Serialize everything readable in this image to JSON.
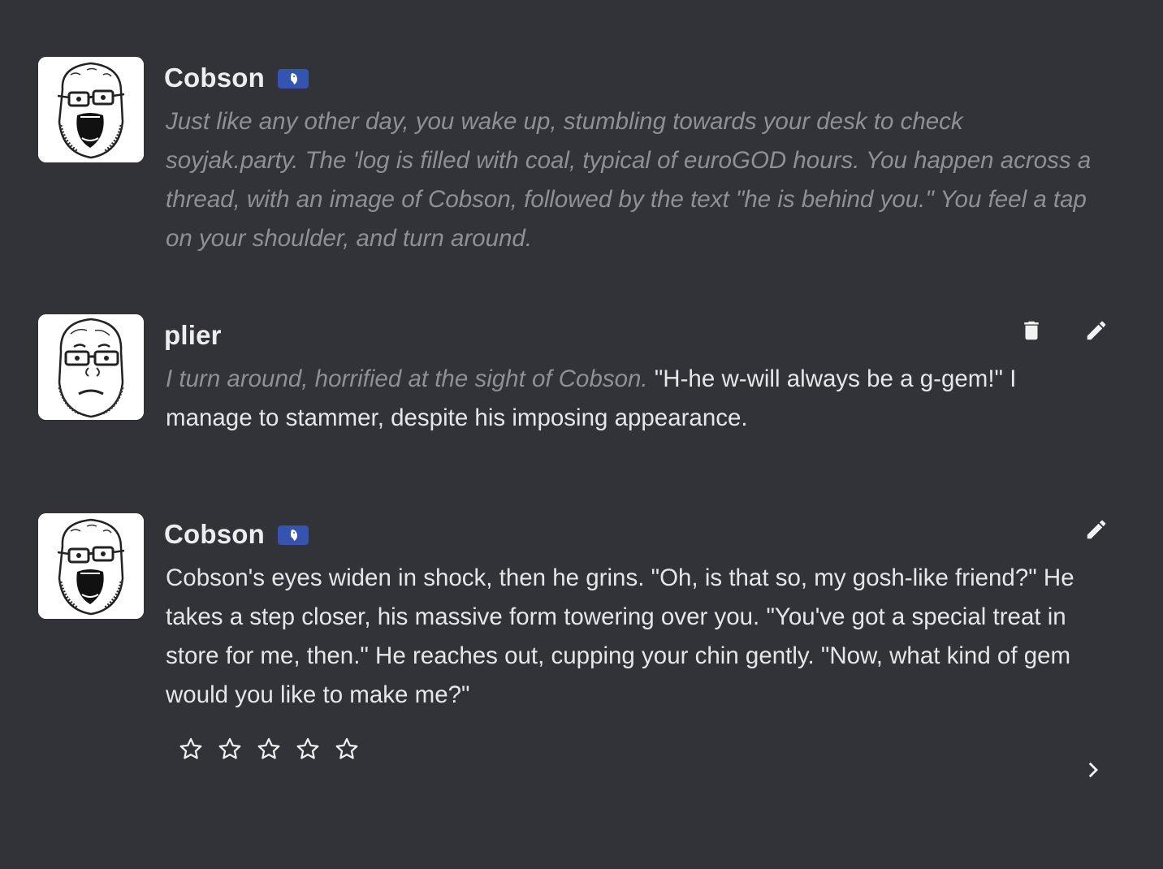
{
  "messages": [
    {
      "author": "Cobson",
      "is_bot": true,
      "avatar": "cobson-avatar",
      "segments": [
        {
          "kind": "action",
          "text": "Just like any other day, you wake up, stumbling towards your desk to check soyjak.party. The 'log is filled with coal, typical of euroGOD hours. You happen across a thread, with an image of Cobson, followed by the text \"he is behind you.\" You feel a tap on your shoulder, and turn around."
        }
      ]
    },
    {
      "author": "plier",
      "is_bot": false,
      "avatar": "plier-avatar",
      "segments": [
        {
          "kind": "action",
          "text": "I turn around, horrified at the sight of Cobson."
        },
        {
          "kind": "speech",
          "text": " \"H-he w-will always be a g-gem!\" I manage to stammer, despite his imposing appearance."
        }
      ]
    },
    {
      "author": "Cobson",
      "is_bot": true,
      "avatar": "cobson-avatar",
      "segments": [
        {
          "kind": "speech",
          "text": "Cobson's eyes widen in shock, then he grins. \"Oh, is that so, my gosh-like friend?\" He takes a step closer, his massive form towering over you. \"You've got a special treat in store for me, then.\" He reaches out, cupping your chin gently. \"Now, what kind of gem would you like to make me?\""
        }
      ]
    }
  ],
  "rating": {
    "value": 0,
    "max": 5
  },
  "icons": {
    "delete": "trash-icon",
    "edit": "pencil-icon",
    "next": "chevron-right-icon",
    "bot_badge": "bot-badge-icon",
    "star": "star-outline-icon"
  },
  "colors": {
    "background": "#323338",
    "text": "#e6e6e8",
    "action_text": "#8f8f95",
    "bot_badge": "#3554b0"
  }
}
